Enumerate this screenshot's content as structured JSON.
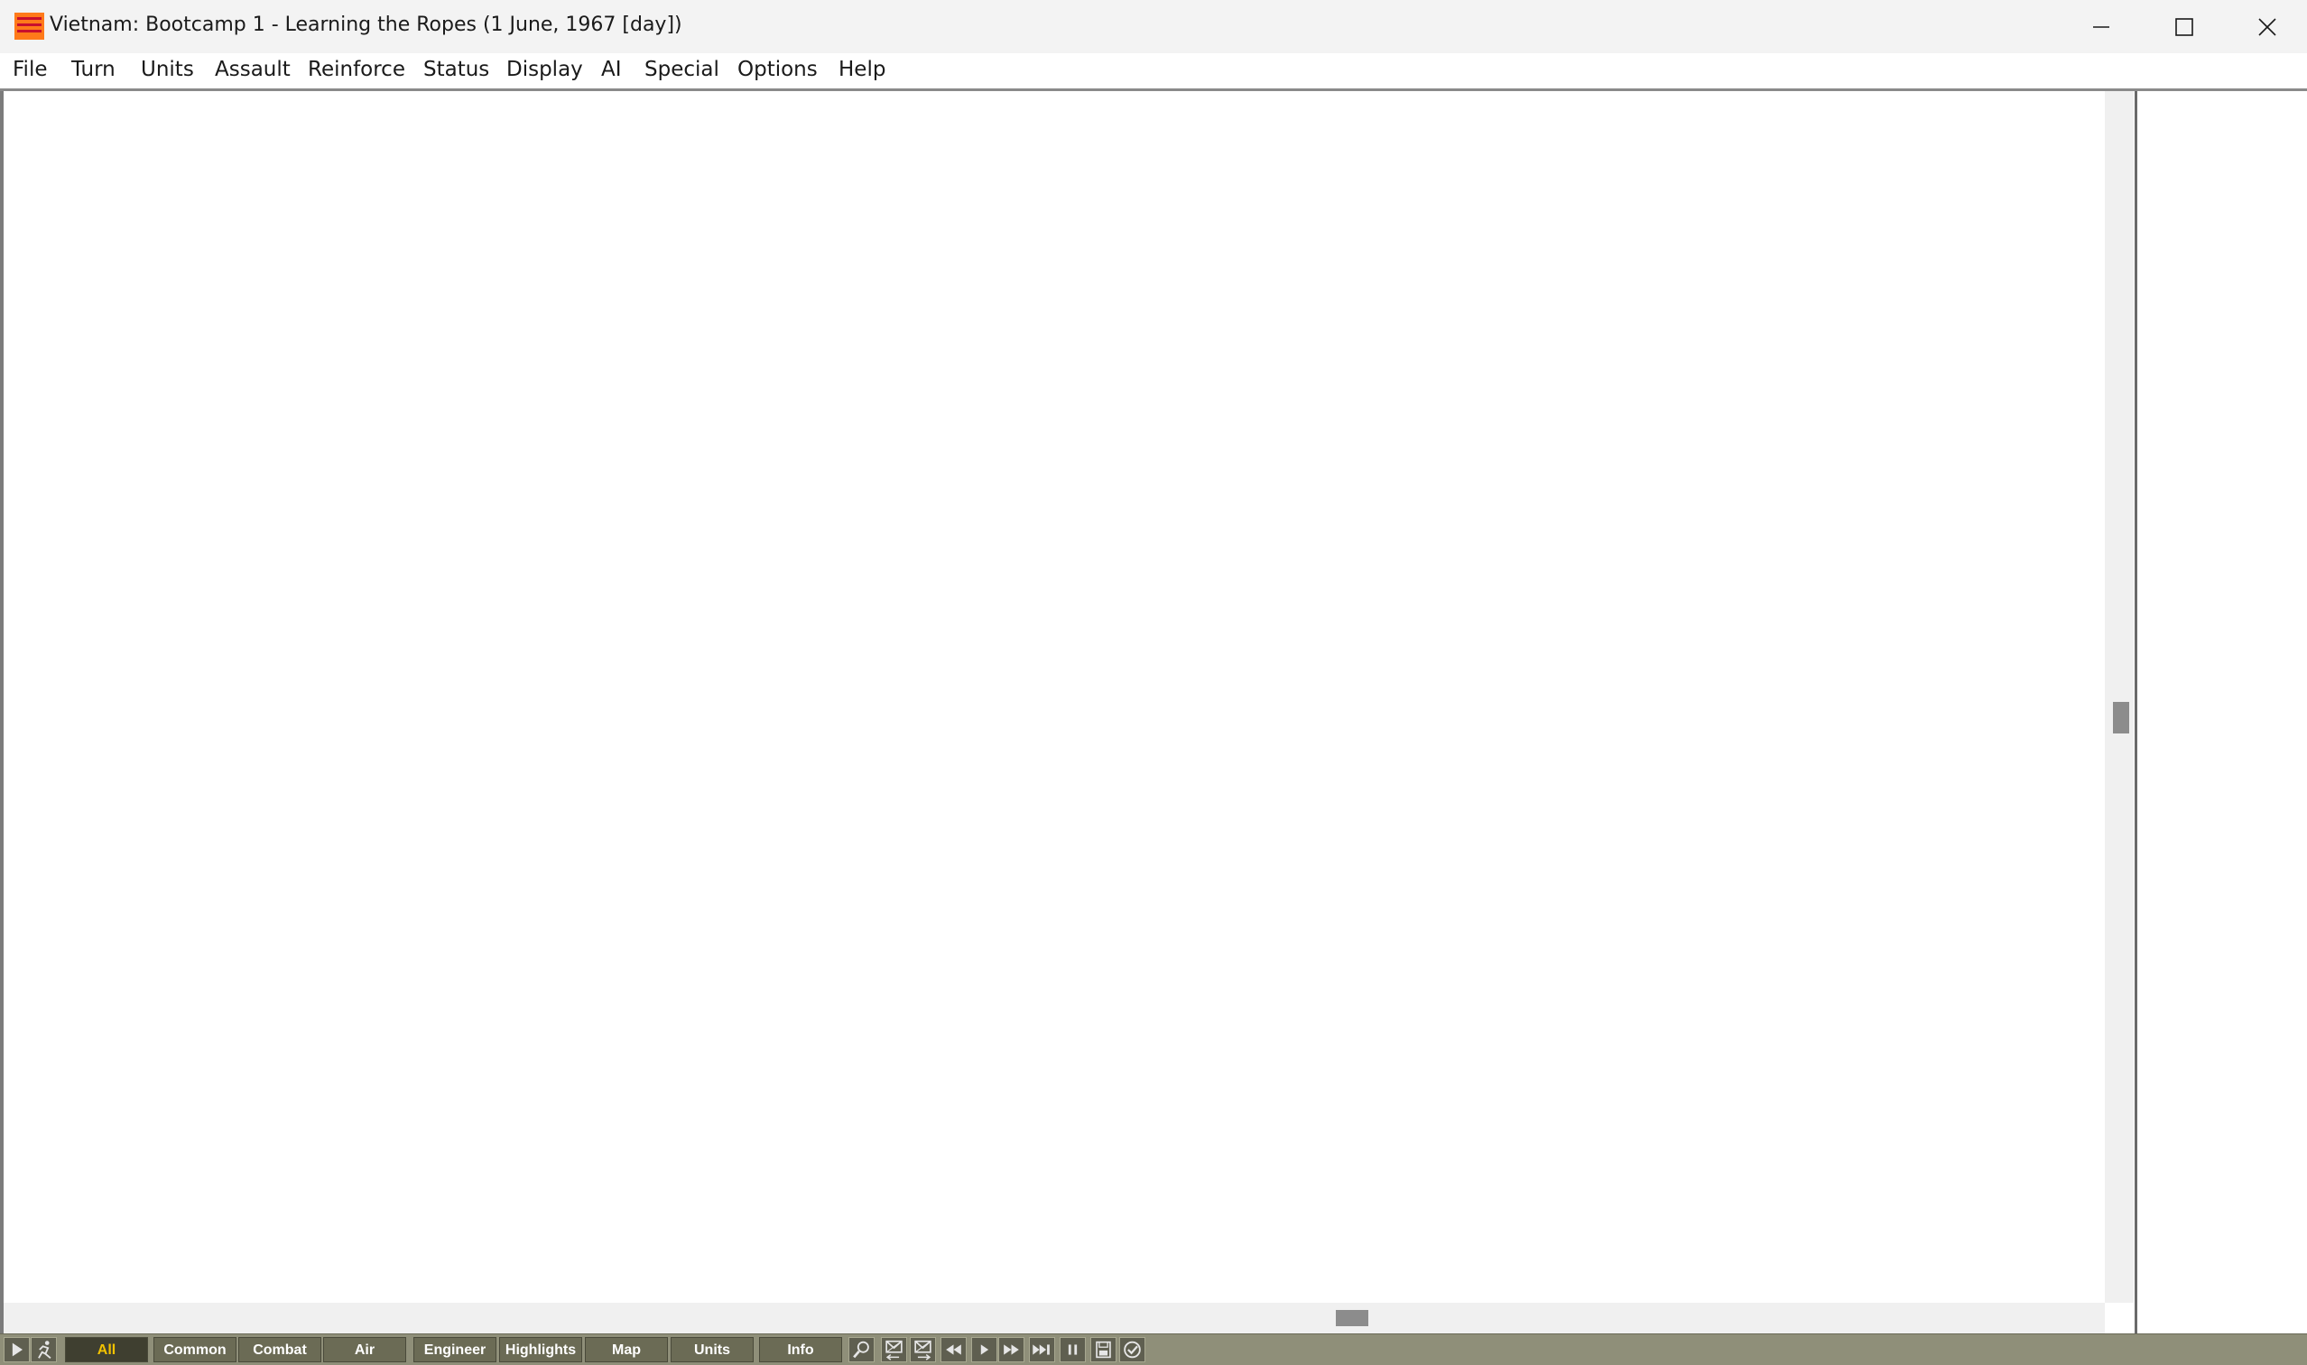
{
  "window": {
    "title": "Vietnam: Bootcamp 1 - Learning the Ropes (1 June, 1967 [day])"
  },
  "menu": [
    "File",
    "Turn",
    "Units",
    "Assault",
    "Reinforce",
    "Status",
    "Display",
    "AI",
    "Special",
    "Options",
    "Help"
  ],
  "toolbar": {
    "tabs": [
      "All",
      "Common",
      "Combat",
      "Air",
      "Engineer",
      "Highlights",
      "Map",
      "Units",
      "Info"
    ],
    "active_tab": "All",
    "active_color": "#f2c200",
    "icons": [
      "play-icon",
      "running-man-icon",
      "search-icon",
      "envelope-prev-icon",
      "envelope-next-icon",
      "rewind-icon",
      "play-small-icon",
      "fast-forward-icon",
      "skip-end-icon",
      "pause-icon",
      "save-icon",
      "check-icon"
    ]
  }
}
